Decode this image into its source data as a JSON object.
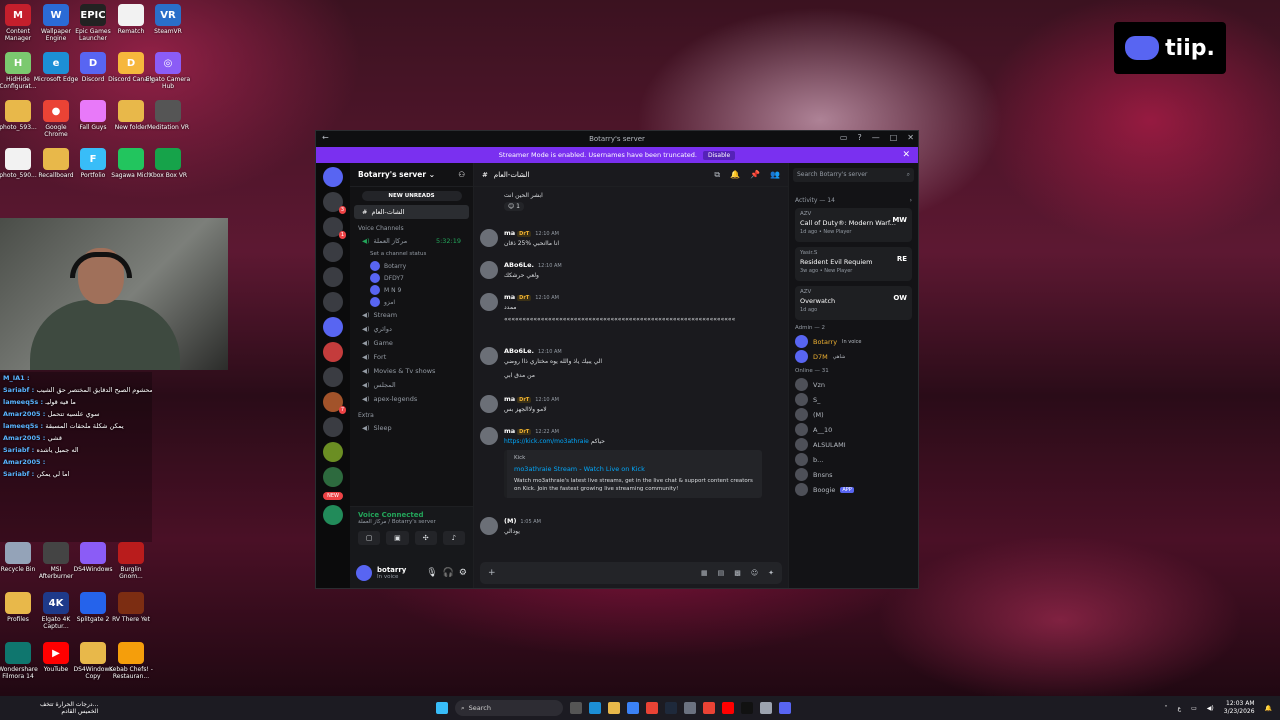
{
  "desktop": {
    "icons": [
      {
        "label": "Content Manager",
        "color": "#c41f2c",
        "glyph": "M"
      },
      {
        "label": "Wallpaper Engine",
        "color": "#2b6bd6",
        "glyph": "W"
      },
      {
        "label": "Epic Games Launcher",
        "color": "#222",
        "glyph": "EPIC"
      },
      {
        "label": "Rematch",
        "color": "#f2f2f2",
        "glyph": ""
      },
      {
        "label": "SteamVR",
        "color": "#2a6fc9",
        "glyph": "VR"
      },
      {
        "label": "HidHide Configurat...",
        "color": "#7bc96f",
        "glyph": "H"
      },
      {
        "label": "Microsoft Edge",
        "color": "#1c8fd6",
        "glyph": "e"
      },
      {
        "label": "Discord",
        "color": "#5865f2",
        "glyph": "D"
      },
      {
        "label": "Discord Canary",
        "color": "#f6b73c",
        "glyph": "D"
      },
      {
        "label": "Elgato Camera Hub",
        "color": "#8b5cf6",
        "glyph": "◎"
      },
      {
        "label": "photo_593...",
        "color": "#e8b84a",
        "glyph": ""
      },
      {
        "label": "Google Chrome",
        "color": "#ea4335",
        "glyph": "●"
      },
      {
        "label": "Fall Guys",
        "color": "#e879f9",
        "glyph": ""
      },
      {
        "label": "New folder",
        "color": "#e8b84a",
        "glyph": ""
      },
      {
        "label": "Meditation VR",
        "color": "#555",
        "glyph": ""
      },
      {
        "label": "photo_590...",
        "color": "#f2f2f2",
        "glyph": ""
      },
      {
        "label": "Recallboard",
        "color": "#e8b84a",
        "glyph": ""
      },
      {
        "label": "Portfolio",
        "color": "#38bdf8",
        "glyph": "F"
      },
      {
        "label": "Sagawa Mich",
        "color": "#22c55e",
        "glyph": ""
      },
      {
        "label": "Xbox Box VR",
        "color": "#16a34a",
        "glyph": ""
      },
      {
        "label": "Recycle Bin",
        "color": "#94a3b8",
        "glyph": ""
      },
      {
        "label": "MSI Afterburner",
        "color": "#444",
        "glyph": ""
      },
      {
        "label": "DS4Windows",
        "color": "#8b5cf6",
        "glyph": ""
      },
      {
        "label": "Burglin Gnom...",
        "color": "#b91c1c",
        "glyph": ""
      },
      {
        "label": "Profiles",
        "color": "#e8b84a",
        "glyph": ""
      },
      {
        "label": "Elgato 4K Captur...",
        "color": "#1e3a8a",
        "glyph": "4K"
      },
      {
        "label": "Splitgate 2",
        "color": "#2563eb",
        "glyph": ""
      },
      {
        "label": "RV There Yet",
        "color": "#7c2d12",
        "glyph": ""
      },
      {
        "label": "Wondershare Filmora 14",
        "color": "#0f766e",
        "glyph": ""
      },
      {
        "label": "YouTube",
        "color": "#ff0000",
        "glyph": "▶"
      },
      {
        "label": "DS4Windows Copy",
        "color": "#e8b84a",
        "glyph": ""
      },
      {
        "label": "Kebab Chefs! - Restauran...",
        "color": "#f59e0b",
        "glyph": ""
      }
    ],
    "chat_overlay": [
      {
        "user": "M_IA1",
        "text": ""
      },
      {
        "user": "Sariabf",
        "text": "لامحشوم الصبح الدقايق المختصر حق الشيب"
      },
      {
        "user": "lameeq5s",
        "text": "ما فيه قوليـ"
      },
      {
        "user": "Amar2005",
        "text": "سوي علسيه تتحمل"
      },
      {
        "user": "lameeq5s",
        "text": "يمكن شكلة ملحقات المسبقة"
      },
      {
        "user": "Amar2005",
        "text": "قشي"
      },
      {
        "user": "Sariabf",
        "text": "اله جميل ياشده"
      },
      {
        "user": "Amar2005",
        "text": ""
      },
      {
        "user": "Sariabf",
        "text": "اما لي يمكن"
      }
    ],
    "brand": "tiip."
  },
  "discord": {
    "window_title": "Botarry's server",
    "banner": {
      "text": "Streamer Mode is enabled. Usernames have been truncated.",
      "button": "Disable"
    },
    "server_name": "Botarry's server",
    "new_unreads": "NEW UNREADS",
    "selected_channel": "الشات-العام",
    "voice_category": "Voice Channels",
    "voice_channel": "مركاز العملة",
    "voice_timer": "5:32:19",
    "voice_status": "Set a channel status",
    "voice_users": [
      "Botarry",
      "DFDY7",
      "M N 9",
      "امزو"
    ],
    "channels": [
      "Stream",
      "دوائري",
      "Game",
      "Fort",
      "Movies & Tv shows",
      "المجلس",
      "apex-legends"
    ],
    "extra_category": "Extra",
    "sleep_channel": "Sleep",
    "voice_connected": "Voice Connected",
    "voice_connected_sub": "مركاز العملة / Botarry's server",
    "user": {
      "name": "botarry",
      "status": "In voice"
    },
    "new_badge": "NEW",
    "header_channel": "الشات-العام",
    "search_placeholder": "Search Botarry's server",
    "messages": [
      {
        "author": "",
        "time": "",
        "text": "ابشر الحين انت",
        "reaction": "1"
      },
      {
        "author": "ma",
        "tag": "DrT",
        "time": "12:10 AM",
        "text": "انا ماانحبي %25 ذقان"
      },
      {
        "author": "ABo6Le.",
        "time": "12:10 AM",
        "text": "ولعي حرشكك"
      },
      {
        "author": "ma",
        "tag": "DrT",
        "time": "12:10 AM",
        "text": "ممدد"
      },
      {
        "author": "",
        "time": "",
        "text": "«««««««««««««««««««««««««««««««««««««««««««««««««««««««««««««««"
      },
      {
        "author": "ABo6Le.",
        "time": "12:10 AM",
        "text": "الي يبيك ياذ والله يوه مختاري ذاا روضي"
      },
      {
        "author": "",
        "time": "",
        "text": "من مدق ابي"
      },
      {
        "author": "ma",
        "tag": "DrT",
        "time": "12:10 AM",
        "text": "لامو ولاالجهز بس"
      },
      {
        "author": "ma",
        "tag": "DrT",
        "time": "12:22 AM",
        "text": "حياكم",
        "link": "https://kick.com/mo3athraie"
      },
      {
        "author": "(M)",
        "time": "1:05 AM",
        "text": "يودالي"
      }
    ],
    "embed": {
      "source": "Kick",
      "title": "mo3athraie Stream - Watch Live on Kick",
      "desc": "Watch mo3athraie's latest live streams, get in the live chat & support content creators on Kick. Join the fastest growing live streaming community!"
    },
    "activity": {
      "title": "Activity — 14",
      "cards": [
        {
          "user": "AZV",
          "game": "Call of Duty®: Modern Warf...",
          "meta": "1d ago",
          "meta2": "New Player",
          "logo": "MW"
        },
        {
          "user": "Yasir.S",
          "game": "Resident Evil Requiem",
          "meta": "3w ago",
          "meta2": "New Player",
          "logo": "RE"
        },
        {
          "user": "AZV",
          "game": "Overwatch",
          "meta": "1d ago",
          "meta2": "",
          "logo": "OW"
        }
      ]
    },
    "admin_title": "Admin — 2",
    "admins": [
      {
        "name": "Botarry",
        "sub": "In voice"
      },
      {
        "name": "D7M",
        "sub": "شاهي"
      }
    ],
    "online_title": "Online — 31",
    "online": [
      "Vzn",
      "S_",
      "(M)",
      "A__10",
      "ALSULAMI",
      "b...",
      "Bnsns",
      "Boogie"
    ],
    "app_badge": "APP"
  },
  "taskbar": {
    "weather": "درجات الحرارة تتخف...",
    "weather2": "الخميس القادم",
    "search": "Search",
    "time": "12:03 AM",
    "date": "3/23/2026",
    "lang": "ع"
  }
}
